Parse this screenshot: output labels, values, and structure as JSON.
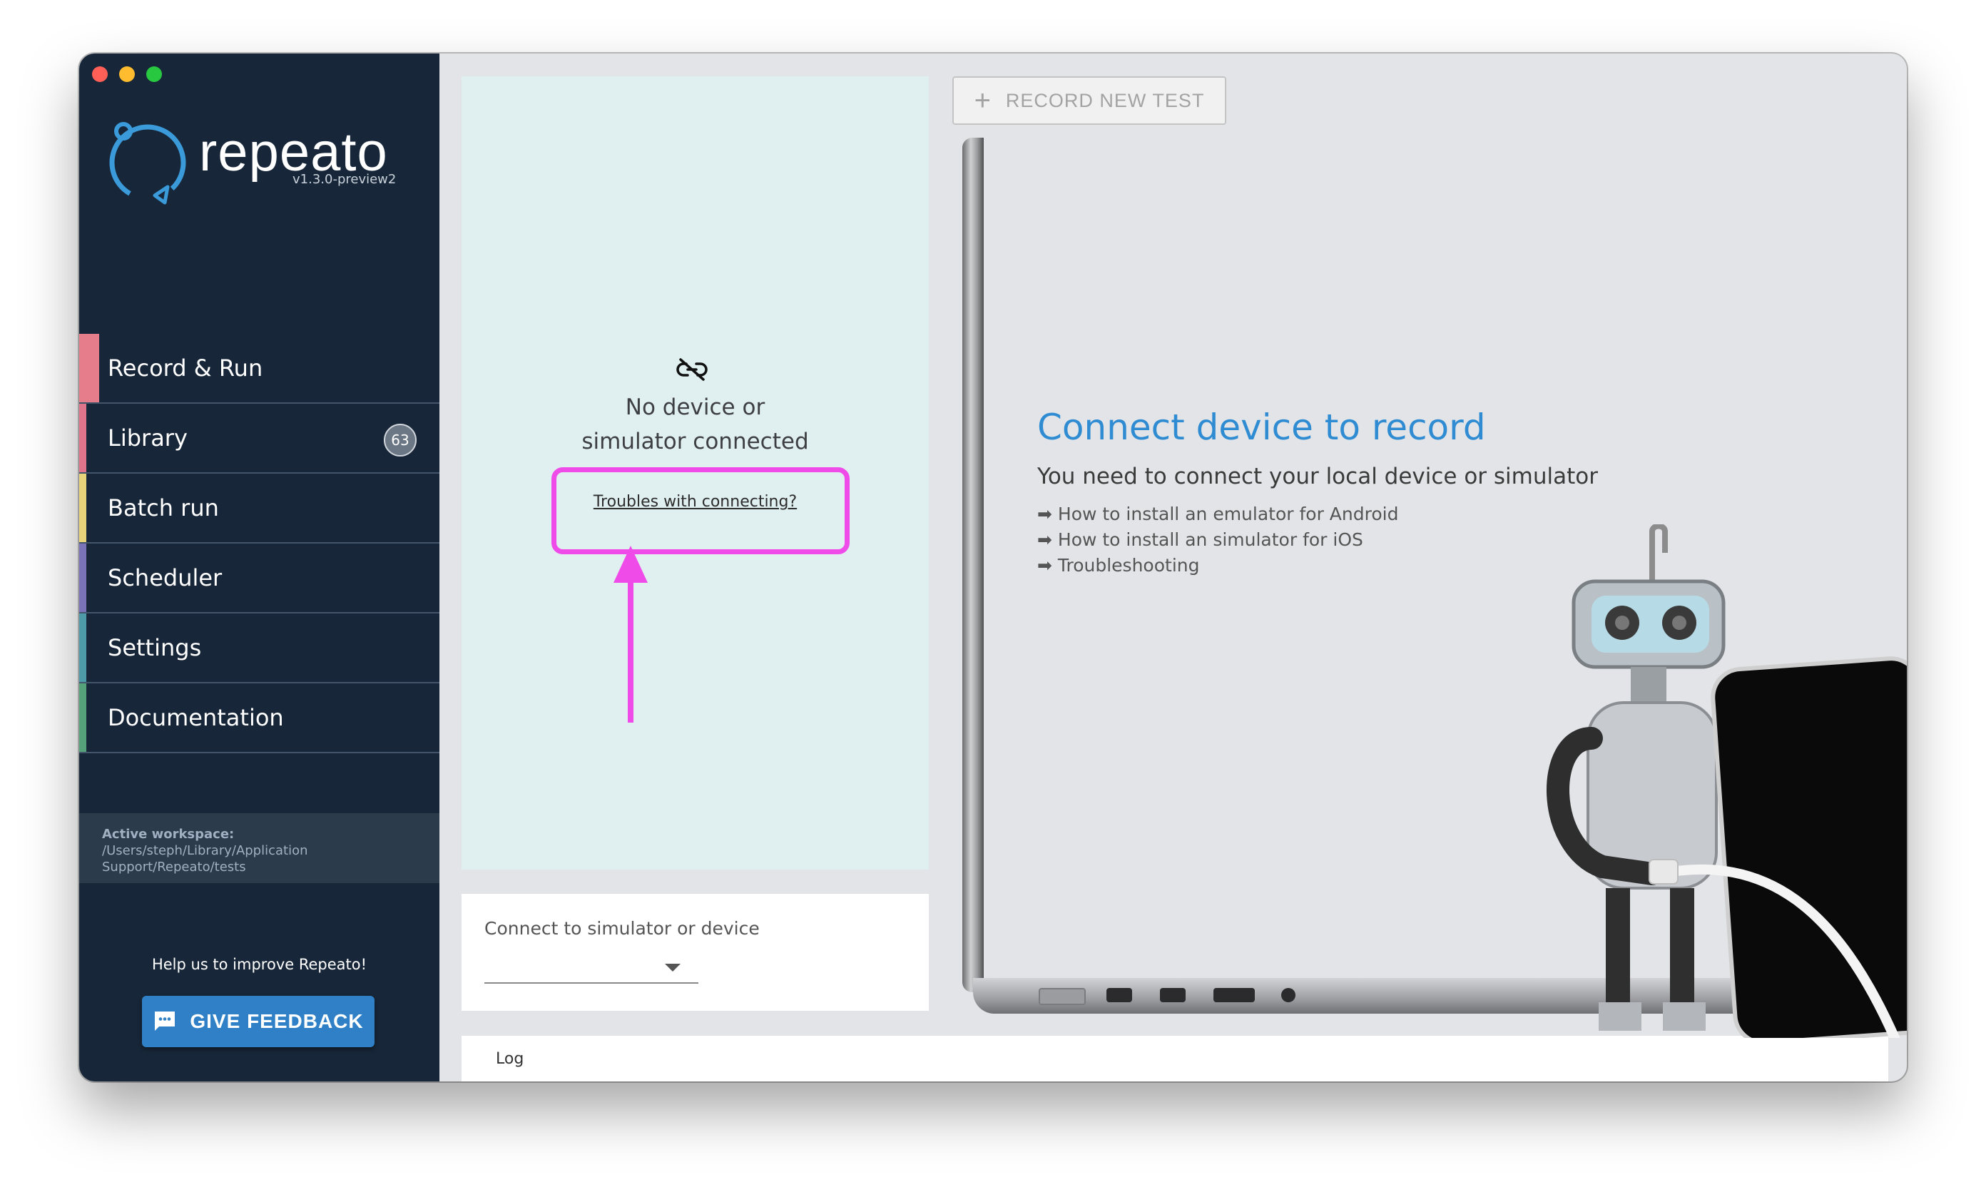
{
  "app": {
    "name": "repeato",
    "version": "v1.3.0-preview2"
  },
  "sidebar": {
    "items": [
      {
        "label": "Record & Run",
        "accent": "#e67d8a"
      },
      {
        "label": "Library",
        "accent": "#e0748b",
        "badge": "63"
      },
      {
        "label": "Batch run",
        "accent": "#e8d27a"
      },
      {
        "label": "Scheduler",
        "accent": "#7b73b8"
      },
      {
        "label": "Settings",
        "accent": "#4f9aa8"
      },
      {
        "label": "Documentation",
        "accent": "#55a17a"
      }
    ],
    "workspace": {
      "label": "Active workspace:",
      "path_line1": "/Users/steph/Library/Application",
      "path_line2": "Support/Repeato/tests"
    },
    "help_text": "Help us to improve Repeato!",
    "feedback_label": "GIVE FEEDBACK"
  },
  "device_panel": {
    "status_line1": "No device or",
    "status_line2": "simulator connected",
    "troubles_link": "Troubles with connecting?",
    "connect_label": "Connect to simulator or device",
    "log_label": "Log"
  },
  "toolbar": {
    "record_label": "RECORD NEW TEST"
  },
  "cta": {
    "title": "Connect device to record",
    "subtitle": "You need to connect your local device or simulator",
    "links": [
      "➡ How to install an emulator for Android",
      "➡ How to install an simulator for iOS",
      "➡ Troubleshooting"
    ]
  },
  "colors": {
    "sidebar_bg": "#172638",
    "accent_blue": "#2f8cd2",
    "highlight": "#ef4be9",
    "feedback_btn": "#2f80c6"
  }
}
